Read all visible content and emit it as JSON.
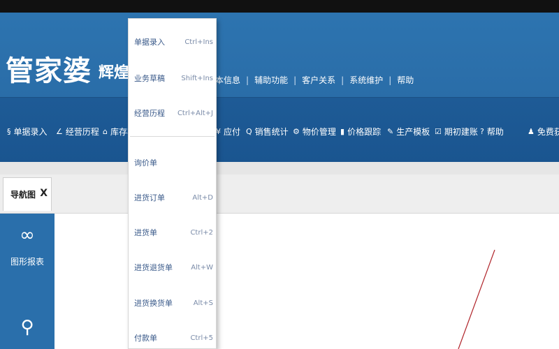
{
  "app": {
    "logo_main": "管家婆",
    "logo_sub": "辉煌ⅡTOP"
  },
  "header_menu": [
    "本信息",
    "辅助功能",
    "客户关系",
    "系统维护",
    "帮助"
  ],
  "toolbar": {
    "items": [
      {
        "icon": "document-icon",
        "glyph": "§",
        "label": "单据录入"
      },
      {
        "icon": "chart-icon",
        "glyph": "∠",
        "label": "经营历程"
      },
      {
        "icon": "box-icon",
        "glyph": "⌂",
        "label": "库存状"
      },
      {
        "icon": "money-icon",
        "glyph": "¥",
        "label": "应付"
      },
      {
        "icon": "search-icon",
        "glyph": "Q",
        "label": "销售统计"
      },
      {
        "icon": "gear-icon",
        "glyph": "⚙",
        "label": "物价管理"
      },
      {
        "icon": "bar-chart-icon",
        "glyph": "▮",
        "label": "价格跟踪"
      },
      {
        "icon": "wrench-icon",
        "glyph": "✎",
        "label": "生产模板"
      },
      {
        "icon": "check-icon",
        "glyph": "☑",
        "label": "期初建账"
      },
      {
        "icon": "help-icon",
        "glyph": "?",
        "label": "帮助"
      },
      {
        "icon": "user-icon",
        "glyph": "♟",
        "label": "免费获取"
      }
    ]
  },
  "tabs": [
    {
      "label": "导航图",
      "close": "X"
    }
  ],
  "sidebar": {
    "items": [
      {
        "icon": "link-icon",
        "glyph": "∞",
        "label": "图形报表"
      },
      {
        "icon": "cart-icon",
        "glyph": "⚲",
        "label": ""
      }
    ]
  },
  "dropdown": {
    "group1": [
      {
        "label": "单据录入",
        "shortcut": "Ctrl+Ins"
      },
      {
        "label": "业务草稿",
        "shortcut": "Shift+Ins"
      },
      {
        "label": "经营历程",
        "shortcut": "Ctrl+Alt+J"
      }
    ],
    "group2": [
      {
        "label": "询价单",
        "shortcut": ""
      },
      {
        "label": "进货订单",
        "shortcut": "Alt+D"
      },
      {
        "label": "进货单",
        "shortcut": "Ctrl+2"
      },
      {
        "label": "进货退货单",
        "shortcut": "Alt+W"
      },
      {
        "label": "进货换货单",
        "shortcut": "Alt+S"
      },
      {
        "label": "付款单",
        "shortcut": "Ctrl+5"
      }
    ]
  }
}
